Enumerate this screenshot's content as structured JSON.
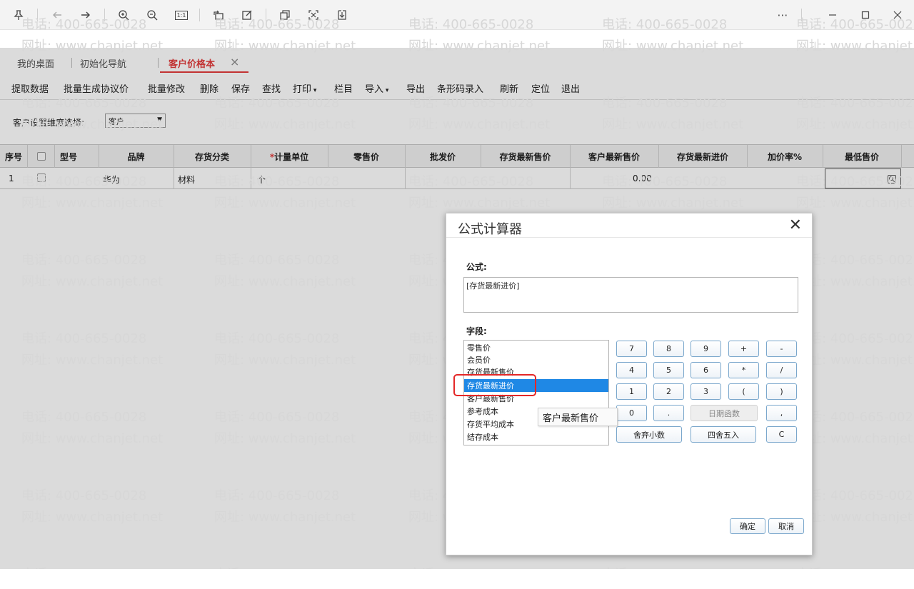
{
  "viewer": {
    "icons": [
      "pin-icon",
      "back-arrow-icon",
      "forward-arrow-icon",
      "zoom-in-icon",
      "zoom-out-icon",
      "actual-size-icon",
      "rotate-icon",
      "edit-icon",
      "ocr-icon",
      "crop-icon",
      "download-icon",
      "more-icon",
      "minimize-icon",
      "maximize-icon",
      "close-icon"
    ],
    "actual_size_label": "1:1"
  },
  "tabs": [
    {
      "label": "我的桌面"
    },
    {
      "label": "初始化导航"
    },
    {
      "label": "客户价格本",
      "active": true
    }
  ],
  "toolbar": [
    "提取数据",
    "批量生成协议价",
    "批量修改",
    "删除",
    "保存",
    "查找",
    "打印",
    "栏目",
    "导入",
    "导出",
    "条形码录入",
    "刷新",
    "定位",
    "退出"
  ],
  "filter": {
    "label": "客户设置维度选择:",
    "value": "客户"
  },
  "grid": {
    "columns": [
      "序号",
      "",
      "型号",
      "品牌",
      "存货分类",
      "计量单位",
      "零售价",
      "批发价",
      "存货最新售价",
      "客户最新售价",
      "存货最新进价",
      "加价率%",
      "最低售价"
    ],
    "required_mark": "*",
    "rows": [
      {
        "index": "1",
        "brand": "华为",
        "category": "材料",
        "unit": "个",
        "customer_latest_price": "0.00"
      }
    ]
  },
  "dialog": {
    "title": "公式计算器",
    "formula_label": "公式:",
    "formula_value": "[存货最新进价]",
    "fields_label": "字段:",
    "fields": [
      "零售价",
      "会员价",
      "存货最新售价",
      "存货最新进价",
      "客户最新售价",
      "参考成本",
      "存货平均成本",
      "结存成本"
    ],
    "selected_field": "存货最新进价",
    "tooltip": "客户最新售价",
    "keys": [
      "7",
      "8",
      "9",
      "+",
      "-",
      "4",
      "5",
      "6",
      "*",
      "/",
      "1",
      "2",
      "3",
      "(",
      ")",
      "0",
      ".",
      "日期函数",
      ","
    ],
    "round_decimal": "舍弃小数",
    "round_half": "四舍五入",
    "clear": "C",
    "ok": "确定",
    "cancel": "取消"
  },
  "watermark": {
    "phone": "电话: 400-665-0028",
    "site": "网址: www.chanjet.net"
  }
}
